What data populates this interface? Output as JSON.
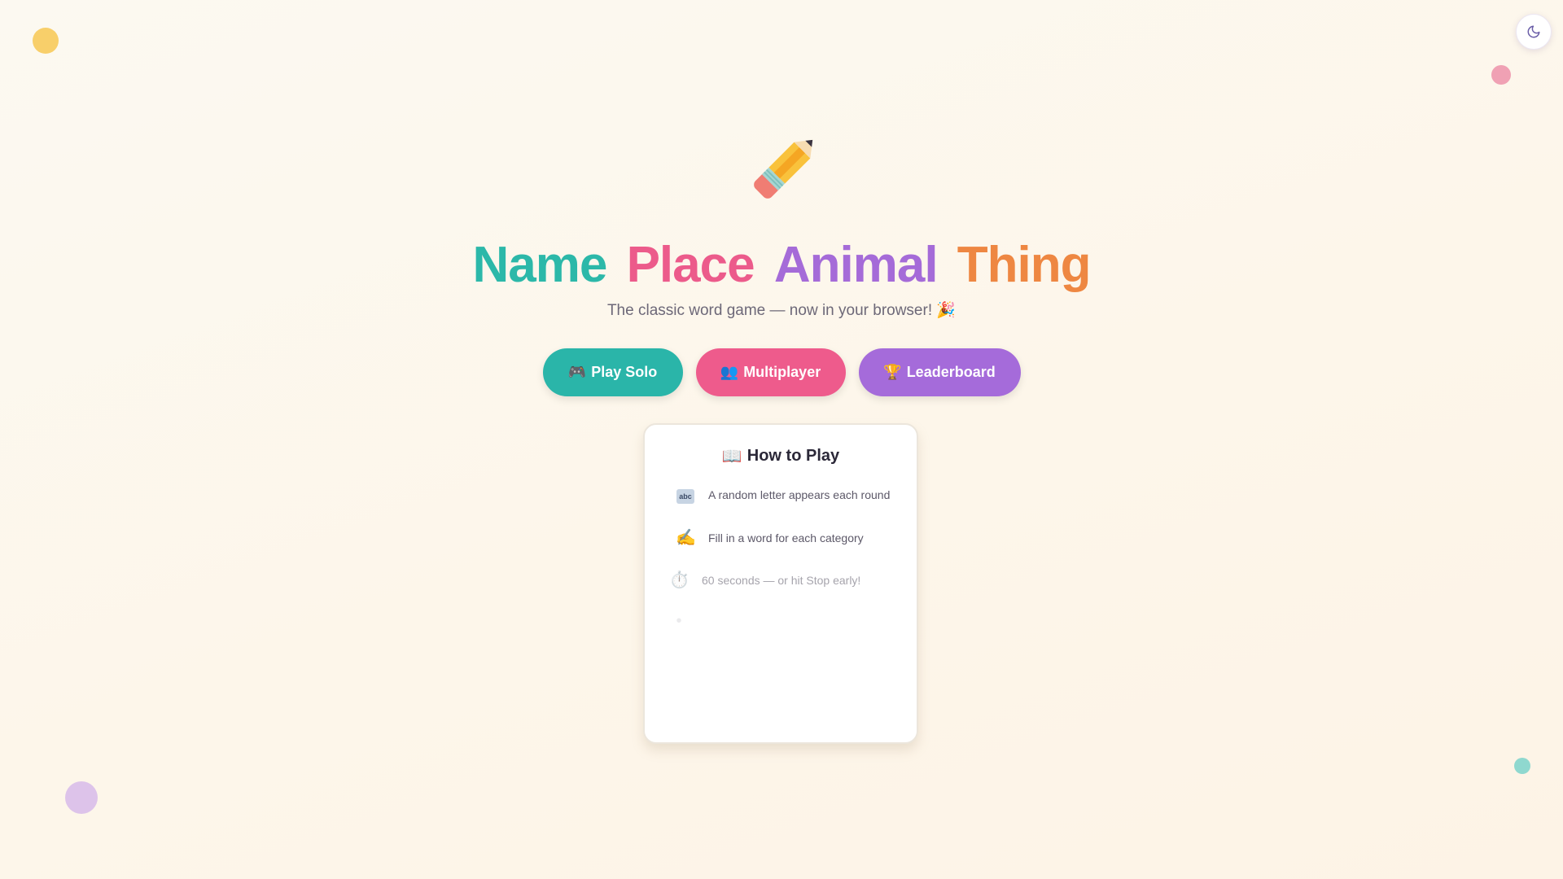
{
  "hero": {
    "icon": "pencil-icon",
    "title_words": [
      "Name",
      "Place",
      "Animal",
      "Thing"
    ],
    "subtitle": "The classic word game — now in your browser! 🎉"
  },
  "actions": {
    "solo": {
      "emoji": "🎮",
      "label": "Play Solo"
    },
    "multiplayer": {
      "emoji": "👥",
      "label": "Multiplayer"
    },
    "leaderboard": {
      "emoji": "🏆",
      "label": "Leaderboard"
    }
  },
  "how_to_play": {
    "emoji": "📖",
    "title": "How to Play",
    "steps": [
      {
        "icon": "abc-icon",
        "text": "A random letter appears each round"
      },
      {
        "icon": "writing-hand-icon",
        "text": "Fill in a word for each category"
      },
      {
        "icon": "stopwatch-icon",
        "text": "60 seconds — or hit Stop early!"
      }
    ]
  },
  "theme_toggle": {
    "icon": "moon-icon"
  },
  "colors": {
    "name": "#2cb8a9",
    "place": "#ec5b8b",
    "animal": "#a56bd8",
    "thing": "#ee8742"
  }
}
